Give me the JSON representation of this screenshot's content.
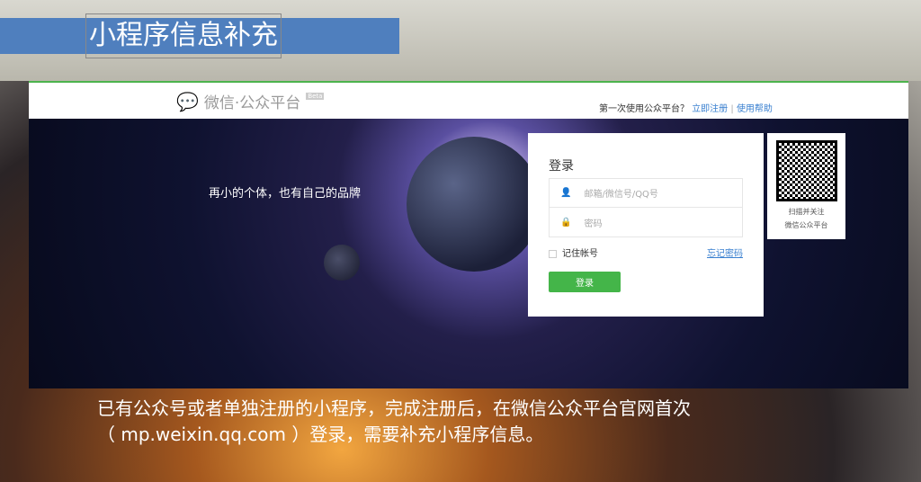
{
  "slide": {
    "title": "小程序信息补充",
    "caption_line1": "已有公众号或者单独注册的小程序，完成注册后，在微信公众平台官网首次",
    "caption_line2": "（ mp.weixin.qq.com ）登录，需要补充小程序信息。"
  },
  "header": {
    "logo_text": "微信·公众平台",
    "beta": "Beta",
    "first_time": "第一次使用公众平台？",
    "register": "立即注册",
    "separator": "|",
    "help": "使用帮助"
  },
  "banner": {
    "slogan": "再小的个体，也有自己的品牌"
  },
  "login": {
    "title": "登录",
    "account_placeholder": "邮箱/微信号/QQ号",
    "password_placeholder": "密码",
    "remember": "记住帐号",
    "forgot": "忘记密码",
    "submit": "登录"
  },
  "qr": {
    "line1": "扫描并关注",
    "line2": "微信公众平台"
  },
  "colors": {
    "accent_green": "#44b549",
    "link_blue": "#3a80d0",
    "title_bar": "#4f7fbe"
  }
}
